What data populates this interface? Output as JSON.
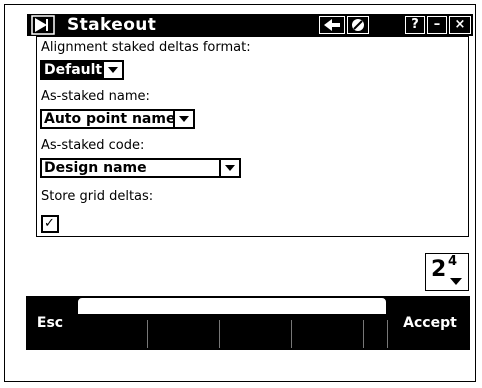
{
  "window": {
    "title": "Stakeout",
    "buttons": {
      "help": "?",
      "minimize": "–",
      "close": "×"
    }
  },
  "form": {
    "alignment_format_label": "Alignment staked deltas format:",
    "alignment_format_value": "Default",
    "as_staked_name_label": "As-staked name:",
    "as_staked_name_value": "Auto point name",
    "as_staked_code_label": "As-staked code:",
    "as_staked_code_value": "Design name",
    "store_grid_deltas_label": "Store grid deltas:",
    "store_grid_deltas_checked": true,
    "checkmark": "✓"
  },
  "pager": {
    "current": "2",
    "total": "4"
  },
  "softkeys": {
    "esc": "Esc",
    "accept": "Accept"
  }
}
